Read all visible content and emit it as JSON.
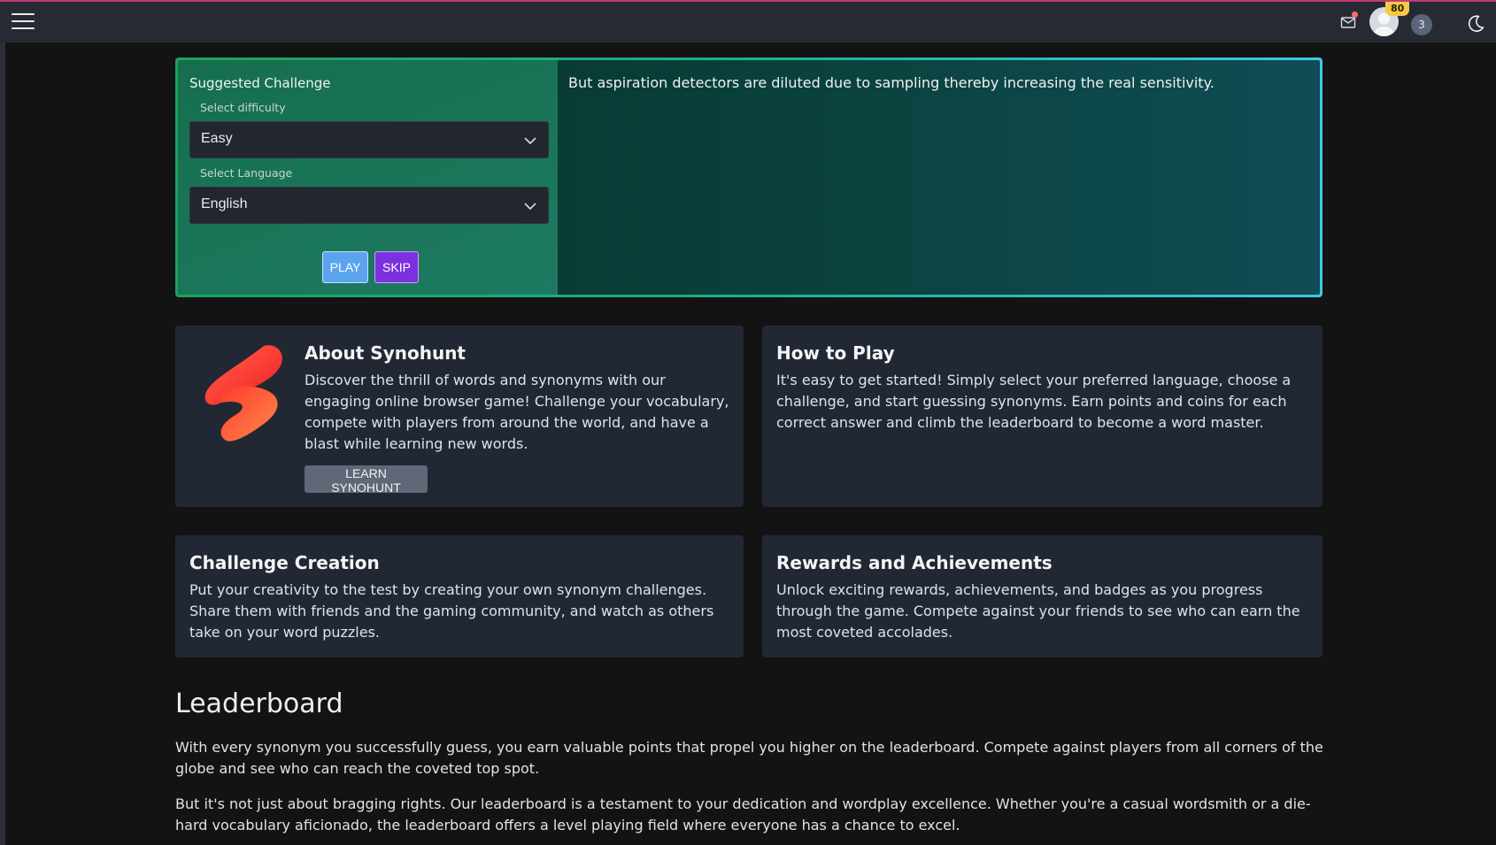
{
  "topbar": {
    "coins": "80",
    "notification_count": "3",
    "icons": [
      "menu-icon",
      "mail-icon",
      "avatar",
      "moon-icon"
    ]
  },
  "challenge": {
    "title": "Suggested Challenge",
    "difficulty_label": "Select difficulty",
    "difficulty_value": "Easy",
    "language_label": "Select Language",
    "language_value": "English",
    "play_label": "PLAY",
    "skip_label": "SKIP",
    "sentence": "But aspiration detectors are diluted due to sampling thereby increasing the real sensitivity."
  },
  "about": {
    "title": "About Synohunt",
    "text": "Discover the thrill of words and synonyms with our engaging online browser game! Challenge your vocabulary, compete with players from around the world, and have a blast while learning new words.",
    "button": "LEARN SYNOHUNT"
  },
  "howto": {
    "title": "How to Play",
    "text": "It's easy to get started! Simply select your preferred language, choose a challenge, and start guessing synonyms. Earn points and coins for each correct answer and climb the leaderboard to become a word master."
  },
  "creation": {
    "title": "Challenge Creation",
    "text": "Put your creativity to the test by creating your own synonym challenges. Share them with friends and the gaming community, and watch as others take on your word puzzles."
  },
  "rewards": {
    "title": "Rewards and Achievements",
    "text": "Unlock exciting rewards, achievements, and badges as you progress through the game. Compete against your friends to see who can earn the most coveted accolades."
  },
  "leaderboard": {
    "title": "Leaderboard",
    "p1": "With every synonym you successfully guess, you earn valuable points that propel you higher on the leaderboard. Compete against players from all corners of the globe and see who can reach the coveted top spot.",
    "p2": "But it's not just about bragging rights. Our leaderboard is a testament to your dedication and wordplay excellence. Whether you're a casual wordsmith or a die-hard vocabulary aficionado, the leaderboard offers a level playing field where everyone has a chance to excel."
  },
  "colors": {
    "accent_green": "#19a35d",
    "accent_cyan": "#3fc8e6",
    "play_blue": "#5aa4ee",
    "skip_purple": "#7d30e0",
    "coin_yellow": "#f6c945"
  }
}
